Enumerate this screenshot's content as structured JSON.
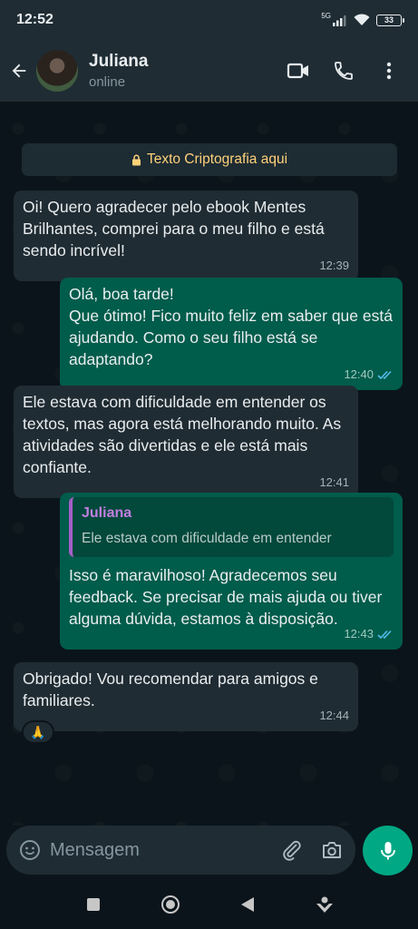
{
  "status_bar": {
    "time": "12:52",
    "network": "5G",
    "battery": "33"
  },
  "header": {
    "contact_name": "Juliana",
    "contact_status": "online"
  },
  "chat": {
    "encryption_notice": "Texto Criptografia aqui",
    "messages": [
      {
        "direction": "incoming",
        "text": "Oi! Quero agradecer pelo ebook Mentes Brilhantes, comprei para o meu filho e está sendo incrível!",
        "time": "12:39"
      },
      {
        "direction": "outgoing",
        "text": "Olá, boa tarde!\nQue ótimo! Fico muito feliz em saber que está ajudando. Como o seu filho está se adaptando?",
        "time": "12:40",
        "read": true
      },
      {
        "direction": "incoming",
        "text": " Ele estava com dificuldade em entender os textos, mas agora está melhorando muito. As atividades são divertidas e ele está mais confiante.",
        "time": "12:41"
      },
      {
        "direction": "outgoing",
        "quote": {
          "author": "Juliana",
          "text": "Ele estava com dificuldade em entender"
        },
        "text": "Isso é maravilhoso! Agradecemos seu feedback. Se precisar de mais ajuda ou tiver alguma dúvida, estamos à disposição.",
        "time": "12:43",
        "read": true
      },
      {
        "direction": "incoming",
        "text": "Obrigado! Vou recomendar para amigos e familiares.",
        "time": "12:44",
        "reaction": "🙏"
      }
    ]
  },
  "composer": {
    "placeholder": "Mensagem"
  },
  "colors": {
    "background": "#0b141a",
    "bar": "#1f2c34",
    "incoming_bubble": "#202c33",
    "outgoing_bubble": "#005c4b",
    "accent": "#00a884",
    "read_ticks": "#53bdeb",
    "encryption_text": "#ffd279"
  }
}
